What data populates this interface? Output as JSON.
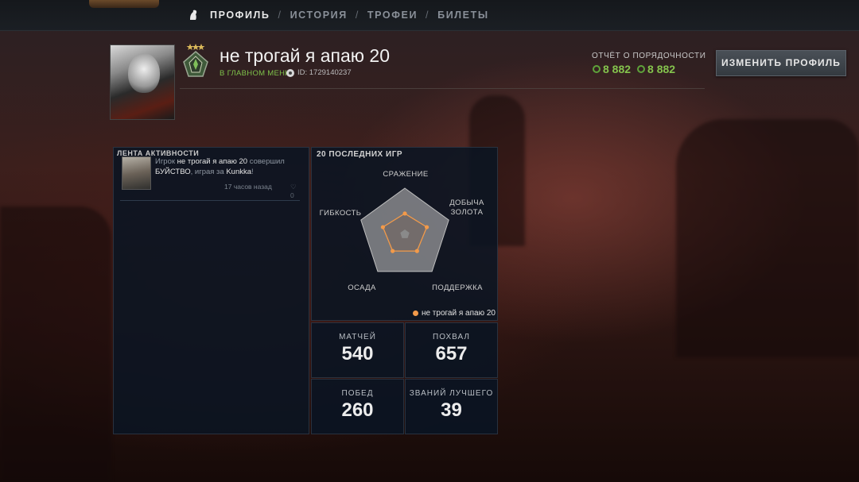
{
  "nav": {
    "tabs": [
      {
        "label": "ПРОФИЛЬ",
        "active": true
      },
      {
        "label": "ИСТОРИЯ",
        "active": false
      },
      {
        "label": "ТРОФЕИ",
        "active": false
      },
      {
        "label": "БИЛЕТЫ",
        "active": false
      }
    ],
    "separator": "/"
  },
  "profile": {
    "name": "не трогай я апаю 20",
    "status": "В ГЛАВНОМ МЕНЮ",
    "steam_id": "ID: 1729140237",
    "avatar_icon": "avatar",
    "rank_icon": "rank-medal-icon"
  },
  "conduct": {
    "title": "ОТЧЁТ О ПОРЯДОЧНОСТИ",
    "values": [
      "8 882",
      "8 882"
    ],
    "color": "#84c34d"
  },
  "edit_button": "ИЗМЕНИТЬ ПРОФИЛЬ",
  "feed": {
    "title": "ЛЕНТА АКТИВНОСТИ",
    "items": [
      {
        "prefix": "Игрок",
        "player": "не трогай я апаю 20",
        "action": "совершил",
        "event": "БУЙСТВО",
        "middle": ", играя за",
        "hero": "Kunkka",
        "suffix": "!",
        "time": "17 часов назад",
        "likes": "0"
      }
    ]
  },
  "games": {
    "title": "20 ПОСЛЕДНИХ ИГР",
    "axes": [
      "СРАЖЕНИЕ",
      "ДОБЫЧА ЗОЛОТА",
      "ПОДДЕРЖКА",
      "ОСАДА",
      "ГИБКОСТЬ"
    ],
    "values": [
      0.45,
      0.5,
      0.45,
      0.45,
      0.5
    ],
    "legend": "не трогай я апаю 20",
    "series_color": "#f29a4a"
  },
  "stats": [
    {
      "label": "МАТЧЕЙ",
      "value": "540"
    },
    {
      "label": "ПОХВАЛ",
      "value": "657"
    },
    {
      "label": "ПОБЕД",
      "value": "260"
    },
    {
      "label": "ЗВАНИЙ ЛУЧШЕГО",
      "value": "39"
    }
  ]
}
